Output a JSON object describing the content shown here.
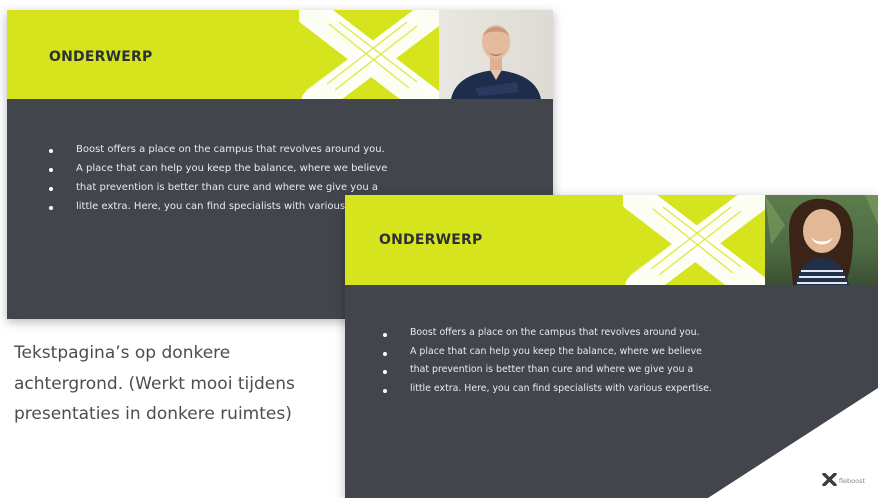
{
  "slides": [
    {
      "title": "ONDERWERP",
      "bullets": [
        "Boost offers a place on the campus that revolves around you.",
        "A place that can help you keep the balance, where we believe",
        "that prevention is better than cure and where we give you a",
        "little extra. Here, you can find specialists with various expertise."
      ]
    },
    {
      "title": "ONDERWERP",
      "bullets": [
        "Boost offers a place on the campus that revolves around you.",
        "A place that can help you keep the balance, where we believe",
        "that prevention is better than cure and where we give you a",
        "little extra. Here, you can find specialists with various expertise."
      ],
      "logo_text": "fleboost"
    }
  ],
  "caption": "Tekstpagina’s op donkere achtergrond. (Werkt mooi tijdens presentaties in donkere ruimtes)",
  "colors": {
    "lime": "#d6e41d",
    "dark": "#42454b",
    "title": "#2d3034",
    "text": "#e9eaec"
  },
  "icons": [
    "brush-x-mark",
    "x-logo-mark"
  ]
}
